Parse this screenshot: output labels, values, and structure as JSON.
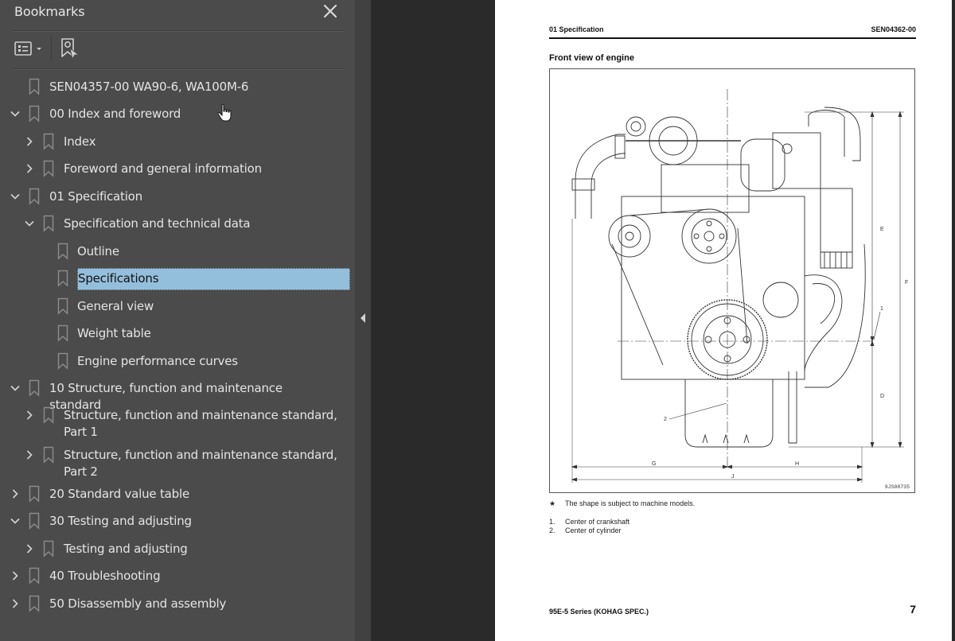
{
  "sidebar": {
    "title": "Bookmarks",
    "close_icon": "close-icon",
    "toolbar": {
      "options_icon": "bookmark-options-icon",
      "find_icon": "find-current-bookmark-icon"
    },
    "items": [
      {
        "label": "SEN04357-00 WA90-6, WA100M-6",
        "level": 0,
        "toggle": "none"
      },
      {
        "label": "00 Index and foreword",
        "level": 0,
        "toggle": "expanded"
      },
      {
        "label": "Index",
        "level": 1,
        "toggle": "collapsed"
      },
      {
        "label": "Foreword and general information",
        "level": 1,
        "toggle": "collapsed"
      },
      {
        "label": "01 Specification",
        "level": 0,
        "toggle": "expanded"
      },
      {
        "label": "Specification and technical data",
        "level": 1,
        "toggle": "expanded"
      },
      {
        "label": "Outline",
        "level": 2,
        "toggle": "none"
      },
      {
        "label": "Specifications",
        "level": 2,
        "toggle": "none",
        "selected": true
      },
      {
        "label": "General view",
        "level": 2,
        "toggle": "none"
      },
      {
        "label": "Weight table",
        "level": 2,
        "toggle": "none"
      },
      {
        "label": "Engine performance curves",
        "level": 2,
        "toggle": "none"
      },
      {
        "label": "10 Structure, function and maintenance standard",
        "level": 0,
        "toggle": "expanded"
      },
      {
        "label": "Structure, function and maintenance standard, Part 1",
        "level": 1,
        "toggle": "collapsed"
      },
      {
        "label": "Structure, function and maintenance standard, Part 2",
        "level": 1,
        "toggle": "collapsed"
      },
      {
        "label": "20 Standard value table",
        "level": 0,
        "toggle": "collapsed"
      },
      {
        "label": "30 Testing and adjusting",
        "level": 0,
        "toggle": "expanded"
      },
      {
        "label": "Testing and adjusting",
        "level": 1,
        "toggle": "collapsed"
      },
      {
        "label": "40 Troubleshooting",
        "level": 0,
        "toggle": "collapsed"
      },
      {
        "label": "50 Disassembly and assembly",
        "level": 0,
        "toggle": "collapsed"
      }
    ]
  },
  "collapse_handle": {
    "icon": "collapse-panel-left-icon"
  },
  "page": {
    "header_left": "01 Specification",
    "header_right": "SEN04362-00",
    "section_title": "Front view of engine",
    "figure": {
      "id": "9JS08735",
      "dimension_labels": [
        "E",
        "F",
        "D",
        "G",
        "H",
        "J"
      ],
      "callouts": [
        "1",
        "2"
      ]
    },
    "star_note": {
      "mark": "★",
      "text": "The shape is subject to machine models."
    },
    "legend": [
      {
        "num": "1.",
        "text": "Center of crankshaft"
      },
      {
        "num": "2.",
        "text": "Center of cylinder"
      }
    ],
    "footer_left": "95E-5 Series (KOHAG SPEC.)",
    "page_number": "7"
  },
  "colors": {
    "sidebar_bg": "#4b4b4b",
    "selection_bg": "#94bfdc",
    "viewer_bg": "#2a2a2a",
    "page_bg": "#ffffff"
  }
}
